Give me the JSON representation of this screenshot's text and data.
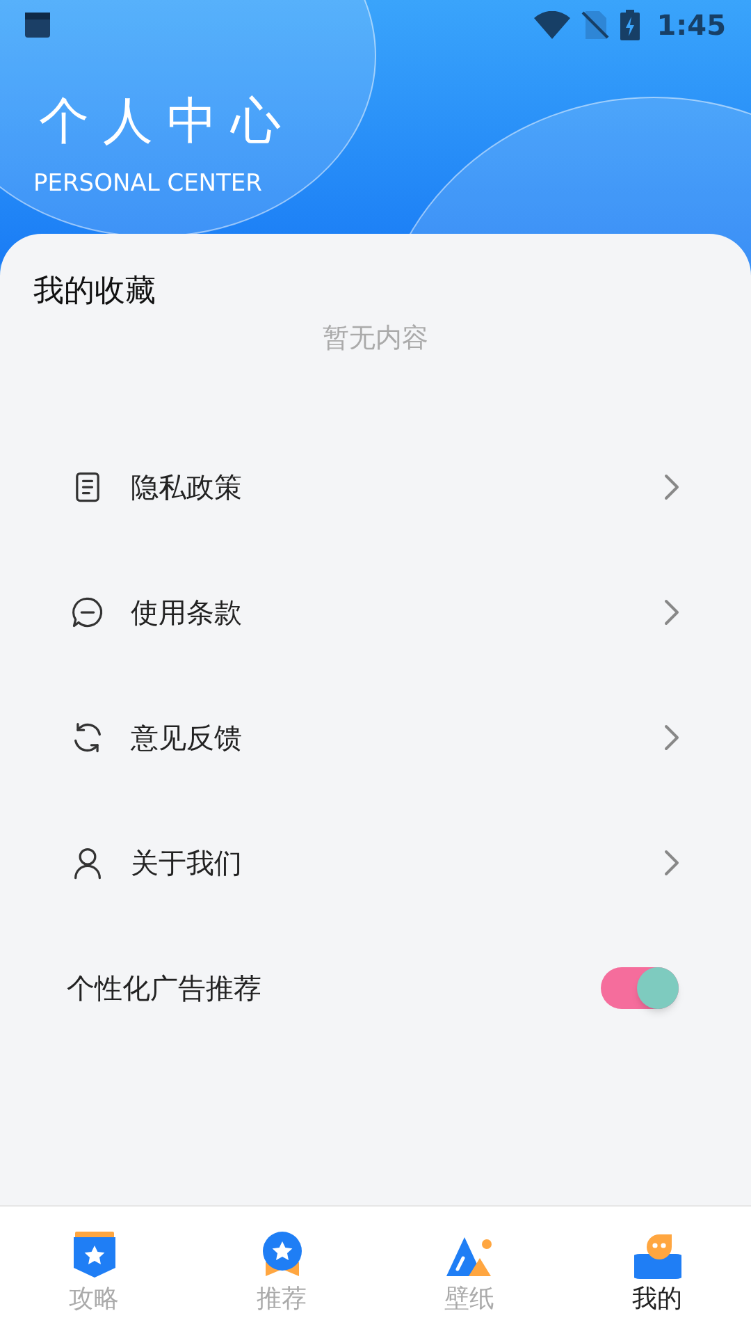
{
  "status_bar": {
    "time": "1:45"
  },
  "header": {
    "title": "个人中心",
    "subtitle": "PERSONAL CENTER"
  },
  "favorites": {
    "title": "我的收藏",
    "empty_text": "暂无内容"
  },
  "menu": [
    {
      "kind": "link",
      "label": "隐私政策"
    },
    {
      "kind": "link",
      "label": "使用条款"
    },
    {
      "kind": "link",
      "label": "意见反馈"
    },
    {
      "kind": "link",
      "label": "关于我们"
    },
    {
      "kind": "toggle",
      "label": "个性化广告推荐",
      "on": true
    }
  ],
  "tabs": [
    {
      "label": "攻略",
      "selected": false
    },
    {
      "label": "推荐",
      "selected": false
    },
    {
      "label": "壁纸",
      "selected": false
    },
    {
      "label": "我的",
      "selected": true
    }
  ]
}
